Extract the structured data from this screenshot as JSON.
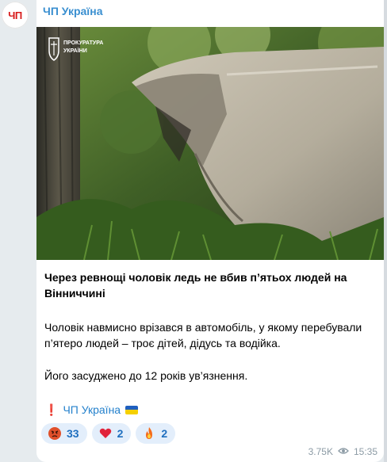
{
  "channel": {
    "avatar_text": "ЧП",
    "name": "ЧП Україна"
  },
  "photo": {
    "watermark": "ПРОКУРАТУРА УКРАЇНИ"
  },
  "post": {
    "title": "Через ревнощі чоловік ледь не вбив п’ятьох людей на Вінниччині",
    "paragraph1": "Чоловік навмисно врізався в автомобіль, у якому перебували п’ятеро людей – троє дітей, дідусь та водійка.",
    "paragraph2": "Його засуджено до 12 років ув’язнення.",
    "signature_mark": "❗",
    "signature_name": "ЧП Україна"
  },
  "reactions": [
    {
      "emoji": "angry-face",
      "count": "33"
    },
    {
      "emoji": "heart",
      "count": "2"
    },
    {
      "emoji": "fire",
      "count": "2"
    }
  ],
  "meta": {
    "views": "3.75K",
    "time": "15:35"
  },
  "colors": {
    "channel_name": "#3a8fd0",
    "link": "#2481cc",
    "reaction_bg": "#e3eefb",
    "avatar_text": "#d71b1b"
  }
}
